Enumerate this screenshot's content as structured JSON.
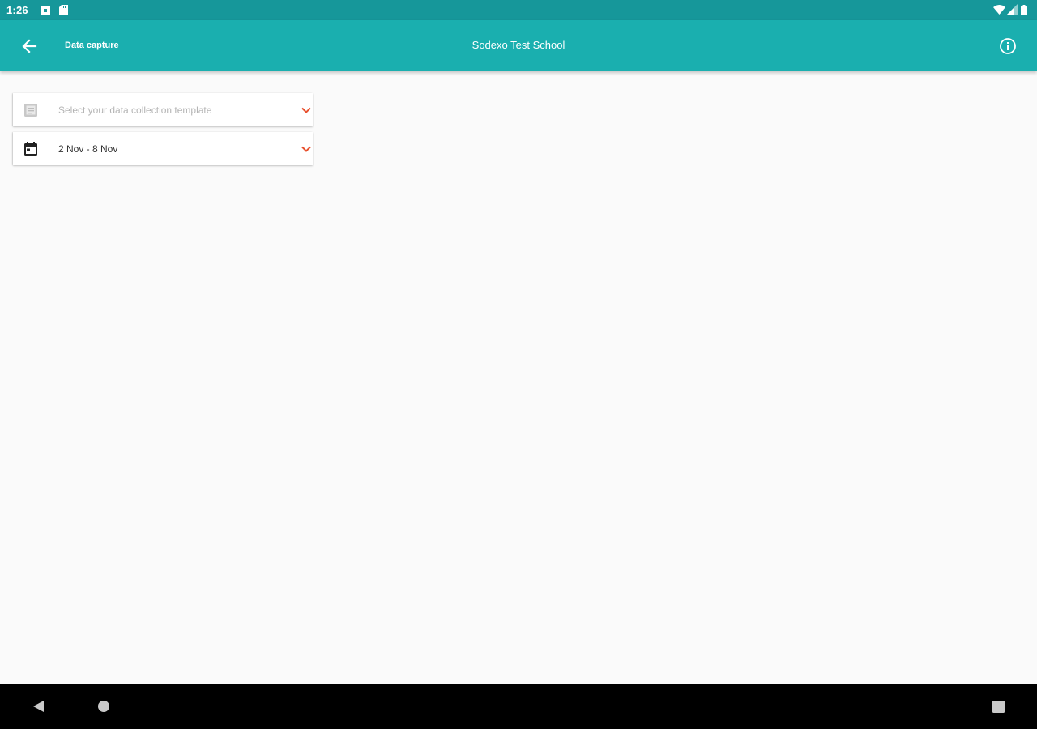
{
  "status_bar": {
    "time": "1:26",
    "left_icons": [
      "notification-app-icon",
      "sd-card-icon"
    ],
    "right_icons": [
      "wifi-icon",
      "signal-icon",
      "battery-icon"
    ]
  },
  "app_bar": {
    "subtitle": "Data capture",
    "title": "Sodexo Test School",
    "back_icon": "arrow-back-icon",
    "info_icon": "info-circle-icon",
    "color": "#1aafaf"
  },
  "filters": {
    "template_select": {
      "icon": "form-icon",
      "placeholder": "Select your data collection template"
    },
    "date_range_select": {
      "icon": "calendar-icon",
      "value": "2 Nov - 8 Nov"
    },
    "chevron_color": "#e8512e"
  },
  "nav_bar": {
    "icons": [
      "back-triangle-icon",
      "home-circle-icon",
      "recents-square-icon"
    ]
  }
}
